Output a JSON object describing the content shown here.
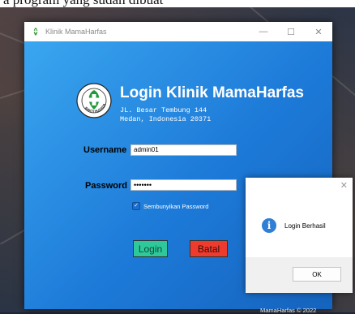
{
  "caption": {
    "text": "a program yang sudah dibuat"
  },
  "window": {
    "title": "Klinik MamaHarfas",
    "minimize": "—",
    "maximize": "☐",
    "close": "✕"
  },
  "login": {
    "heading": "Login Klinik MamaHarfas",
    "address_line1": "JL. Besar Tembung 144",
    "address_line2": "Medan, Indonesia 20371",
    "username_label": "Username",
    "username_value": "admin01",
    "password_label": "Password",
    "password_value": "•••••••",
    "checkbox_label": "Sembunyikan Password",
    "checkbox_checked": true,
    "login_button": "Login",
    "cancel_button": "Batal",
    "footer": "MamaHarfas © 2022",
    "logo_text": "BAKTI HUSADA",
    "colors": {
      "login_button": "#2ec89a",
      "cancel_button": "#ef3b2d",
      "panel": "#1d7ad8"
    }
  },
  "dialog": {
    "close": "✕",
    "icon": "info-icon",
    "icon_glyph": "i",
    "message": "Login Berhasil",
    "ok_button": "OK"
  }
}
